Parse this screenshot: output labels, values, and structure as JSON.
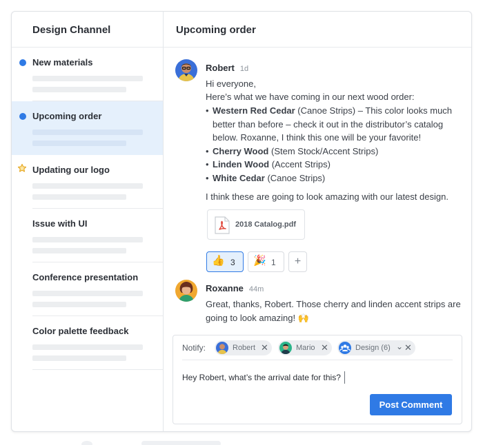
{
  "sidebar": {
    "title": "Design Channel",
    "items": [
      {
        "label": "New materials",
        "marker": "unread-dot"
      },
      {
        "label": "Upcoming order",
        "marker": "unread-dot",
        "selected": true
      },
      {
        "label": "Updating our logo",
        "marker": "star-icon"
      },
      {
        "label": "Issue with UI",
        "marker": "none"
      },
      {
        "label": "Conference presentation",
        "marker": "none"
      },
      {
        "label": "Color palette feedback",
        "marker": "none"
      }
    ]
  },
  "thread": {
    "title": "Upcoming order",
    "messages": [
      {
        "author": "Robert",
        "time": "1d",
        "greeting": "Hi everyone,",
        "intro": "Here’s what we have coming in our next wood order:",
        "items": [
          {
            "name": "Western Red Cedar",
            "detail": " (Canoe Strips) – This color looks much better than before – check it out in the distributor’s catalog below. Roxanne, I think this one will be your favorite!"
          },
          {
            "name": "Cherry Wood",
            "detail": " (Stem Stock/Accent Strips)"
          },
          {
            "name": "Linden Wood",
            "detail": " (Accent Strips)"
          },
          {
            "name": "White Cedar",
            "detail": " (Canoe Strips)"
          }
        ],
        "closing": "I think these are going to look amazing with our latest design.",
        "attachment": {
          "name": "2018 Catalog.pdf",
          "icon": "pdf-icon"
        },
        "reactions": [
          {
            "emoji": "👍",
            "count": "3",
            "active": true
          },
          {
            "emoji": "🎉",
            "count": "1",
            "active": false
          }
        ],
        "add_reaction": "+"
      },
      {
        "author": "Roxanne",
        "time": "44m",
        "body": "Great, thanks, Robert. Those cherry and linden accent strips are going to look amazing! 🙌"
      }
    ]
  },
  "composer": {
    "notify_label": "Notify:",
    "chips": [
      {
        "name": "Robert",
        "remove": "✕"
      },
      {
        "name": "Mario",
        "remove": "✕"
      },
      {
        "name": "Design (6)",
        "expand": "⌄",
        "remove": "✕"
      }
    ],
    "draft_text": "Hey Robert, what’s the arrival date for this?",
    "post_label": "Post Comment"
  },
  "colors": {
    "accent": "#2f7ae5",
    "selected_bg": "#e5f0fc",
    "star": "#e6a821",
    "pdf_red": "#e0463a"
  }
}
